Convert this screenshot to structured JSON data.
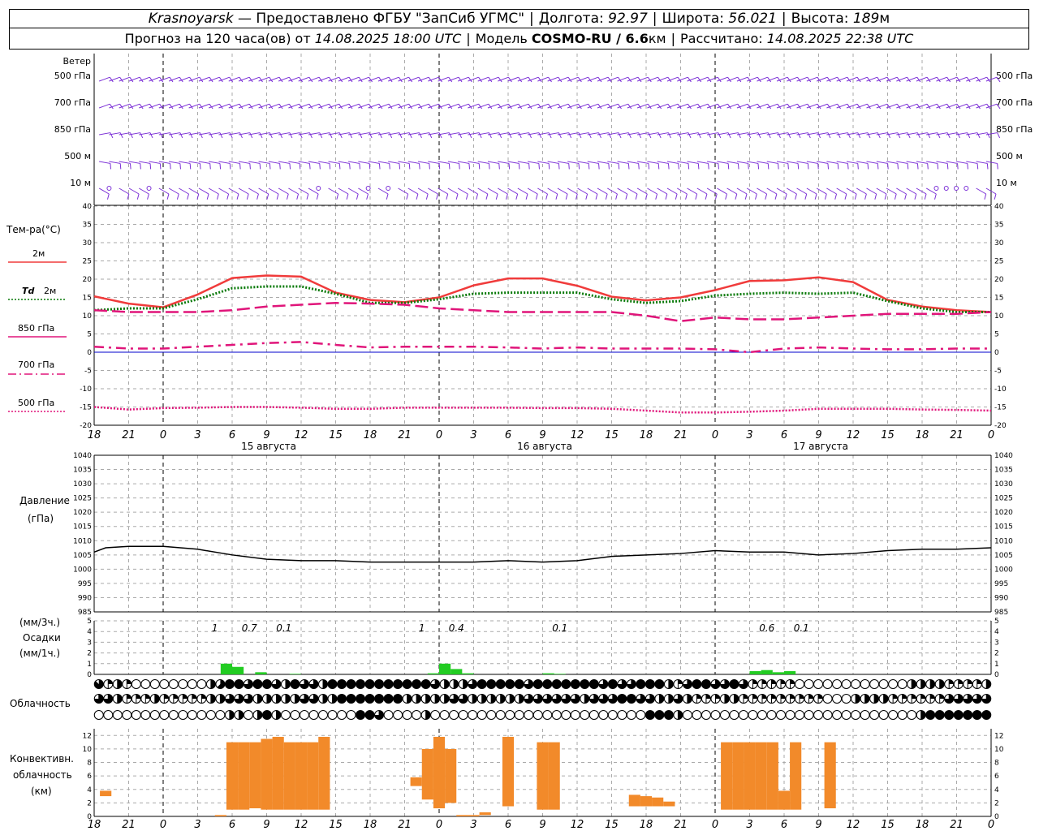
{
  "header": {
    "city": "Krasnoyarsk",
    "dash": "—",
    "provider": "Предоставлено ФГБУ \"ЗапСиб УГМС\"",
    "lon_label": "Долгота:",
    "lon": "92.97",
    "lat_label": "Широта:",
    "lat": "56.021",
    "alt_label": "Высота:",
    "alt": "189",
    "alt_unit": "м",
    "forecast_prefix": "Прогноз на 120 часа(ов) от",
    "forecast_time": "14.08.2025 18:00 UTC",
    "model_label": "Модель",
    "model": "COSMO-RU / 6.6",
    "model_unit": "км",
    "calc_label": "Рассчитано:",
    "calc_time": "14.08.2025 22:38 UTC"
  },
  "colors": {
    "wind": "#7b2fd6",
    "t2m": "#f03b3b",
    "td2m": "#0a7a0a",
    "t850": "#e0157a",
    "t700": "#e0157a",
    "t500": "#e0157a",
    "pressure": "#000000",
    "precip": "#22cc22",
    "convective": "#f28a2a",
    "zero_line": "#0000cc"
  },
  "labels": {
    "wind": "Ветер",
    "wind_levels": [
      "500 гПа",
      "700 гПа",
      "850 гПа",
      "500 м",
      "10 м"
    ],
    "temp": "Тем-ра(°С)",
    "t2m": "2м",
    "td": "Td",
    "td2m": "2м",
    "t850": "850 гПа",
    "t700": "700 гПа",
    "t500": "500 гПа",
    "pressure1": "Давление",
    "pressure2": "(гПа)",
    "precip1": "(мм/3ч.)",
    "precip2": "Осадки",
    "precip3": "(мм/1ч.)",
    "cloud": "Облачность",
    "conv1": "Конвективн.",
    "conv2": "облачность",
    "conv3": "(км)"
  },
  "time_axis": {
    "tick_labels": [
      "18",
      "21",
      "0",
      "3",
      "6",
      "9",
      "12",
      "15",
      "18",
      "21",
      "0",
      "3",
      "6",
      "9",
      "12",
      "15",
      "18",
      "21",
      "0",
      "3",
      "6",
      "9",
      "12",
      "15",
      "18",
      "21",
      "0"
    ],
    "dates": [
      {
        "label": "15 августа",
        "index": 6
      },
      {
        "label": "16 августа",
        "index": 14
      },
      {
        "label": "17 августа",
        "index": 22
      }
    ]
  },
  "chart_data": [
    {
      "type": "line",
      "name": "temperature",
      "ylim": [
        -20,
        40
      ],
      "yticks": [
        40,
        35,
        30,
        25,
        20,
        15,
        10,
        5,
        0,
        -5,
        -10,
        -15,
        -20
      ],
      "x_hours": [
        0,
        3,
        6,
        9,
        12,
        15,
        18,
        21,
        24,
        27,
        30,
        33,
        36,
        39,
        42,
        45,
        48,
        51,
        54,
        57,
        60,
        63,
        66,
        69,
        72,
        75,
        78
      ],
      "series": [
        {
          "name": "2м",
          "style": "solid",
          "values": [
            15.3,
            13.3,
            12.3,
            15.8,
            20.3,
            21.0,
            20.7,
            16.3,
            14.3,
            13.7,
            15.0,
            18.3,
            20.2,
            20.2,
            18.2,
            15.2,
            14.2,
            15.0,
            17.0,
            19.5,
            19.7,
            20.5,
            19.2,
            14.3,
            12.5,
            11.5,
            11.0
          ]
        },
        {
          "name": "Td 2м",
          "style": "dotted",
          "values": [
            11.5,
            12.0,
            12.0,
            14.5,
            17.5,
            18.0,
            18.0,
            16.0,
            13.5,
            13.5,
            14.5,
            16.0,
            16.3,
            16.3,
            16.3,
            14.5,
            13.5,
            14.0,
            15.5,
            16.0,
            16.3,
            16.0,
            16.3,
            14.0,
            12.0,
            11.0,
            11.0
          ]
        },
        {
          "name": "850 гПа",
          "style": "dash",
          "values": [
            11.5,
            11.0,
            11.0,
            11.0,
            11.5,
            12.5,
            13.0,
            13.5,
            13.3,
            13.0,
            12.0,
            11.5,
            11.0,
            11.0,
            11.0,
            11.0,
            10.0,
            8.5,
            9.5,
            9.0,
            9.0,
            9.5,
            10.0,
            10.5,
            10.5,
            10.5,
            11.0
          ]
        },
        {
          "name": "700 гПа",
          "style": "dashdot",
          "values": [
            1.5,
            1.0,
            1.0,
            1.5,
            2.0,
            2.5,
            2.8,
            2.0,
            1.3,
            1.5,
            1.5,
            1.5,
            1.3,
            1.0,
            1.3,
            1.0,
            1.0,
            1.0,
            0.8,
            0.0,
            1.0,
            1.3,
            1.0,
            0.8,
            0.8,
            1.0,
            1.0
          ]
        },
        {
          "name": "500 гПа",
          "style": "dense",
          "values": [
            -15.0,
            -15.7,
            -15.3,
            -15.2,
            -15.0,
            -15.0,
            -15.2,
            -15.5,
            -15.5,
            -15.2,
            -15.2,
            -15.2,
            -15.2,
            -15.3,
            -15.3,
            -15.5,
            -16.0,
            -16.5,
            -16.5,
            -16.3,
            -16.0,
            -15.5,
            -15.5,
            -15.5,
            -15.7,
            -15.8,
            -16.0
          ]
        }
      ]
    },
    {
      "type": "line",
      "name": "pressure",
      "ylim": [
        985,
        1040
      ],
      "yticks": [
        1040,
        1035,
        1030,
        1025,
        1020,
        1015,
        1010,
        1005,
        1000,
        995,
        990,
        985
      ],
      "x_hours": [
        0,
        1,
        3,
        6,
        9,
        12,
        15,
        18,
        21,
        24,
        27,
        30,
        33,
        36,
        39,
        42,
        45,
        48,
        51,
        54,
        57,
        60,
        63,
        66,
        69,
        72,
        75,
        78
      ],
      "values": [
        1006.0,
        1007.5,
        1008.0,
        1008.0,
        1007.0,
        1005.0,
        1003.5,
        1003.0,
        1003.0,
        1002.5,
        1002.5,
        1002.5,
        1002.5,
        1003.0,
        1002.5,
        1003.0,
        1004.5,
        1005.0,
        1005.5,
        1006.5,
        1006.0,
        1006.0,
        1005.0,
        1005.5,
        1006.5,
        1007.0,
        1007.0,
        1007.5
      ]
    },
    {
      "type": "bar",
      "name": "precipitation",
      "ylim": [
        0,
        5
      ],
      "yticks": [
        5,
        4,
        3,
        2,
        1,
        0
      ],
      "bars": [
        {
          "hour": 11.5,
          "value": 1.0
        },
        {
          "hour": 12.5,
          "value": 0.7
        },
        {
          "hour": 14.5,
          "value": 0.2
        },
        {
          "hour": 17.5,
          "value": 0.05
        },
        {
          "hour": 29.5,
          "value": 0.1
        },
        {
          "hour": 30.5,
          "value": 1.0
        },
        {
          "hour": 31.5,
          "value": 0.5
        },
        {
          "hour": 32.5,
          "value": 0.1
        },
        {
          "hour": 39.5,
          "value": 0.1
        },
        {
          "hour": 40.5,
          "value": 0.05
        },
        {
          "hour": 57.5,
          "value": 0.3
        },
        {
          "hour": 58.5,
          "value": 0.4
        },
        {
          "hour": 59.5,
          "value": 0.2
        },
        {
          "hour": 60.5,
          "value": 0.3
        }
      ],
      "totals": [
        {
          "hour": 10.5,
          "label": "1"
        },
        {
          "hour": 13.5,
          "label": "0.7"
        },
        {
          "hour": 16.5,
          "label": "0.1"
        },
        {
          "hour": 28.5,
          "label": "1"
        },
        {
          "hour": 31.5,
          "label": "0.4"
        },
        {
          "hour": 40.5,
          "label": "0.1"
        },
        {
          "hour": 58.5,
          "label": "0.6"
        },
        {
          "hour": 61.5,
          "label": "0.1"
        }
      ]
    },
    {
      "type": "table",
      "name": "cloudiness",
      "levels": [
        "high",
        "middle",
        "low"
      ],
      "coverage_eighths": {
        "high": [
          7,
          2,
          4,
          2,
          0,
          0,
          0,
          0,
          0,
          0,
          0,
          0,
          4,
          5,
          8,
          8,
          6,
          8,
          8,
          6,
          4,
          8,
          6,
          6,
          4,
          8,
          8,
          8,
          8,
          8,
          8,
          8,
          8,
          8,
          8,
          8,
          6,
          4,
          4,
          4,
          6,
          8,
          8,
          8,
          8,
          8,
          6,
          8,
          8,
          8,
          8,
          8,
          8,
          8,
          6,
          8,
          6,
          6,
          8,
          8,
          8,
          4,
          2,
          6,
          8,
          8,
          6,
          6,
          8,
          6,
          2,
          2,
          2,
          2,
          2,
          0,
          0,
          0,
          0,
          0,
          0,
          0,
          0,
          0,
          0,
          0,
          0,
          4,
          4,
          4,
          4,
          2,
          2,
          2,
          2,
          4
        ],
        "middle": [
          6,
          6,
          4,
          2,
          2,
          2,
          4,
          2,
          2,
          2,
          2,
          2,
          4,
          4,
          6,
          6,
          6,
          4,
          4,
          4,
          4,
          4,
          6,
          6,
          4,
          4,
          8,
          8,
          8,
          8,
          8,
          8,
          8,
          4,
          4,
          4,
          4,
          4,
          6,
          6,
          4,
          4,
          4,
          4,
          4,
          4,
          6,
          6,
          6,
          6,
          6,
          6,
          4,
          6,
          6,
          6,
          8,
          8,
          6,
          6,
          4,
          4,
          6,
          4,
          2,
          2,
          2,
          4,
          4,
          2,
          2,
          2,
          2,
          2,
          2,
          2,
          2,
          2,
          0,
          0,
          0,
          4,
          4,
          4,
          4,
          2,
          2,
          2,
          2,
          2,
          2,
          6,
          6,
          6,
          6,
          6
        ],
        "low": [
          0,
          0,
          0,
          0,
          0,
          0,
          0,
          0,
          0,
          0,
          0,
          0,
          0,
          0,
          4,
          4,
          0,
          4,
          8,
          4,
          0,
          0,
          0,
          0,
          0,
          0,
          0,
          0,
          8,
          8,
          6,
          0,
          0,
          0,
          0,
          4,
          0,
          0,
          0,
          0,
          0,
          0,
          0,
          0,
          0,
          0,
          0,
          0,
          0,
          0,
          0,
          0,
          0,
          0,
          0,
          0,
          0,
          0,
          0,
          8,
          8,
          8,
          4,
          0,
          0,
          0,
          0,
          0,
          0,
          0,
          0,
          0,
          0,
          0,
          0,
          0,
          0,
          0,
          0,
          0,
          0,
          0,
          0,
          0,
          0,
          0,
          0,
          0,
          4,
          8,
          8,
          8,
          8,
          8,
          8,
          8
        ]
      }
    },
    {
      "type": "bar",
      "name": "convective",
      "ylim": [
        0,
        13
      ],
      "yticks": [
        12,
        10,
        8,
        6,
        4,
        2,
        0
      ],
      "bars": [
        {
          "hour": 1,
          "base": 3.0,
          "top": 3.8
        },
        {
          "hour": 11,
          "base": 0.0,
          "top": 0.2
        },
        {
          "hour": 12,
          "base": 1.0,
          "top": 11.0
        },
        {
          "hour": 13,
          "base": 1.0,
          "top": 11.0
        },
        {
          "hour": 14,
          "base": 1.2,
          "top": 11.0
        },
        {
          "hour": 15,
          "base": 1.0,
          "top": 11.5
        },
        {
          "hour": 16,
          "base": 1.0,
          "top": 11.8
        },
        {
          "hour": 17,
          "base": 1.0,
          "top": 11.0
        },
        {
          "hour": 18,
          "base": 1.0,
          "top": 11.0
        },
        {
          "hour": 19,
          "base": 1.0,
          "top": 11.0
        },
        {
          "hour": 20,
          "base": 1.0,
          "top": 11.8
        },
        {
          "hour": 28,
          "base": 4.5,
          "top": 5.8
        },
        {
          "hour": 29,
          "base": 2.5,
          "top": 10.0
        },
        {
          "hour": 30,
          "base": 1.2,
          "top": 11.8
        },
        {
          "hour": 31,
          "base": 2.0,
          "top": 10.0
        },
        {
          "hour": 32,
          "base": 0.0,
          "top": 0.2
        },
        {
          "hour": 33,
          "base": 0.0,
          "top": 0.2
        },
        {
          "hour": 34,
          "base": 0.2,
          "top": 0.6
        },
        {
          "hour": 36,
          "base": 1.5,
          "top": 11.8
        },
        {
          "hour": 39,
          "base": 1.0,
          "top": 11.0
        },
        {
          "hour": 40,
          "base": 1.0,
          "top": 11.0
        },
        {
          "hour": 47,
          "base": 1.5,
          "top": 3.2
        },
        {
          "hour": 48,
          "base": 1.5,
          "top": 3.0
        },
        {
          "hour": 49,
          "base": 1.5,
          "top": 2.8
        },
        {
          "hour": 50,
          "base": 1.5,
          "top": 2.2
        },
        {
          "hour": 55,
          "base": 1.0,
          "top": 11.0
        },
        {
          "hour": 56,
          "base": 1.0,
          "top": 11.0
        },
        {
          "hour": 57,
          "base": 1.0,
          "top": 11.0
        },
        {
          "hour": 58,
          "base": 1.0,
          "top": 11.0
        },
        {
          "hour": 59,
          "base": 1.0,
          "top": 11.0
        },
        {
          "hour": 60,
          "base": 1.0,
          "top": 3.8
        },
        {
          "hour": 61,
          "base": 1.0,
          "top": 11.0
        },
        {
          "hour": 64,
          "base": 1.2,
          "top": 11.0
        }
      ]
    },
    {
      "type": "scatter",
      "name": "wind",
      "levels": [
        "500 гПа",
        "700 гПа",
        "850 гПа",
        "500 м",
        "10 м"
      ],
      "barb_count": 90,
      "direction_deg": {
        "500 гПа": 250,
        "700 гПа": 250,
        "850 гПа": 260,
        "500 м": 280,
        "10 м": 300
      },
      "calm_hours_10m": [
        1.5,
        4.5,
        19.5,
        23.5,
        25.5,
        73.5,
        74.5,
        75.5
      ]
    }
  ]
}
